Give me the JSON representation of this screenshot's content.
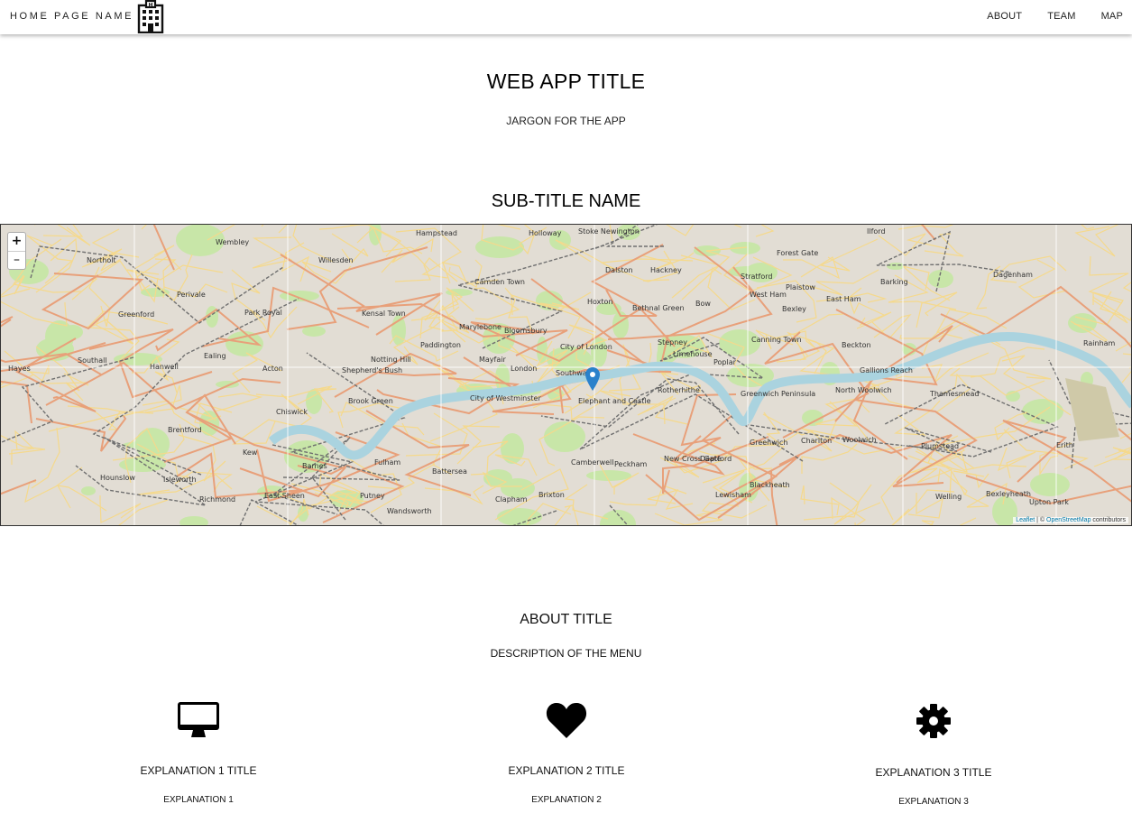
{
  "navbar": {
    "brand": "HOME PAGE NAME",
    "brand_icon": "office-building-icon",
    "links": [
      "ABOUT",
      "TEAM",
      "MAP"
    ]
  },
  "hero": {
    "title": "WEB APP TITLE",
    "jargon": "JARGON FOR THE APP"
  },
  "map_section": {
    "subtitle": "SUB-TITLE NAME",
    "zoom_in": "+",
    "zoom_out": "–",
    "attribution": {
      "leaflet": "Leaflet",
      "separator": " | © ",
      "osm": "OpenStreetMap",
      "suffix": " contributors"
    },
    "labels": [
      "Wembley",
      "Northolt",
      "Hampstead",
      "Holloway",
      "Stoke Newington",
      "Hackney",
      "Ilford",
      "Willesden",
      "Camden Town",
      "Dalston",
      "Stratford",
      "Forest Gate",
      "Barking",
      "Perivale",
      "Greenford",
      "Park Royal",
      "Kensal Town",
      "Marylebone",
      "Bloomsbury",
      "Hoxton",
      "Bethnal Green",
      "Bow",
      "West Ham",
      "East Ham",
      "Dagenham",
      "Southall",
      "Ealing",
      "Acton",
      "Shepherd's Bush",
      "Notting Hill",
      "Paddington",
      "Mayfair",
      "London",
      "City of London",
      "Stepney",
      "Limehouse",
      "Poplar",
      "Canning Town",
      "Beckton",
      "Gallions Reach",
      "Hayes",
      "Hanwell",
      "Chiswick",
      "Brook Green",
      "City of Westminster",
      "Southwark",
      "Elephant and Castle",
      "Rotherhithe",
      "Greenwich Peninsula",
      "North Woolwich",
      "Thamesmead",
      "Brentford",
      "Hounslow",
      "Isleworth",
      "Kew",
      "Barnes",
      "Fulham",
      "Battersea",
      "Brixton",
      "Peckham",
      "Deptford",
      "Greenwich",
      "Charlton",
      "Woolwich",
      "Plumstead",
      "Erith",
      "Richmond",
      "East Sheen",
      "Putney",
      "Wandsworth",
      "Clapham",
      "Camberwell",
      "New Cross Gate",
      "Lewisham",
      "Blackheath",
      "Welling",
      "Bexleyheath",
      "Upton Park",
      "Plaistow",
      "Bexley",
      "Rainham"
    ],
    "marker_icon": "map-pin-icon"
  },
  "about": {
    "title": "ABOUT TITLE",
    "description": "DESCRIPTION OF THE MENU",
    "features": [
      {
        "icon": "desktop-icon",
        "title": "EXPLANATION 1 TITLE",
        "text": "EXPLANATION 1"
      },
      {
        "icon": "heart-icon",
        "title": "EXPLANATION 2 TITLE",
        "text": "EXPLANATION 2"
      },
      {
        "icon": "gear-icon",
        "title": "EXPLANATION 3 TITLE",
        "text": "EXPLANATION 3"
      }
    ]
  },
  "colors": {
    "river": "#aad3df",
    "park": "#c8e6a8",
    "urban": "#e2ddd4",
    "road_major": "#e8a07a",
    "road_minor": "#f7e29a",
    "rail": "#6f6f6f",
    "marker": "#2a81cb"
  }
}
